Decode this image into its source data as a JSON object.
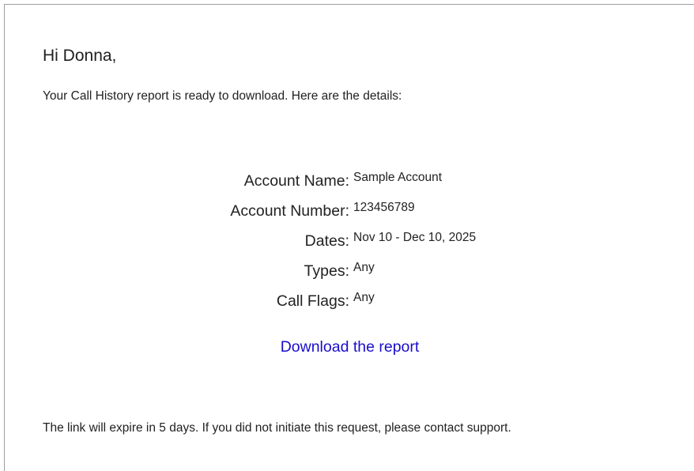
{
  "email": {
    "greeting": "Hi Donna,",
    "intro": "Your Call History report is ready to download. Here are the details:",
    "details": [
      {
        "label": "Account Name:",
        "value": "Sample Account"
      },
      {
        "label": "Account Number:",
        "value": "123456789"
      },
      {
        "label": "Dates:",
        "value": "Nov 10 - Dec 10, 2025"
      },
      {
        "label": "Types:",
        "value": "Any"
      },
      {
        "label": "Call Flags:",
        "value": "Any"
      }
    ],
    "download_link": "Download the report",
    "footer_note": "The link will expire in 5 days. If you did not initiate this request, please contact support."
  },
  "colors": {
    "link": "#1a0dcc",
    "text": "#222222",
    "frame_border": "#9e9e9e"
  }
}
